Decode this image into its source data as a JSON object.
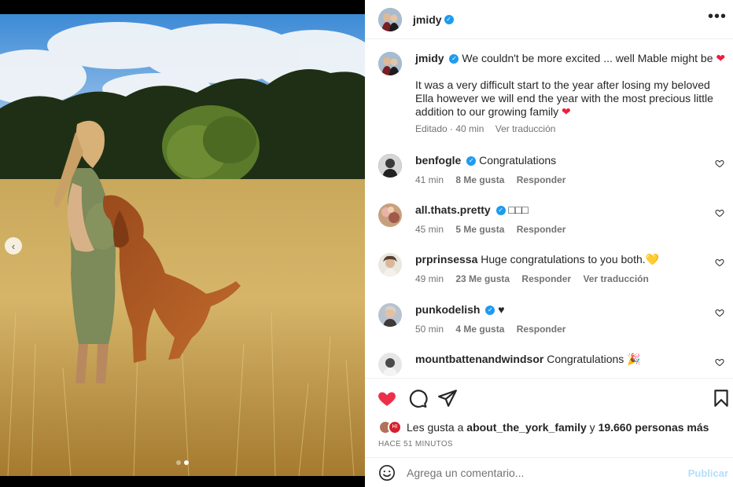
{
  "post": {
    "author": "jmidy",
    "verified": true
  },
  "header": {
    "username": "jmidy",
    "more_icon": "more-horizontal-icon"
  },
  "caption": {
    "username": "jmidy",
    "line1": "We couldn't be more excited ... well Mable might be",
    "line2": "It was a very difficult start to the year after losing my beloved Ella however we will end the year with the most precious little addition to our growing family",
    "emoji": "❤",
    "edited": "Editado · 40 min",
    "translate": "Ver traducción"
  },
  "comments": [
    {
      "username": "benfogle",
      "verified": true,
      "text": "Congratulations",
      "time": "41 min",
      "likes": "8 Me gusta",
      "reply": "Responder",
      "translate": ""
    },
    {
      "username": "all.thats.pretty",
      "verified": true,
      "text": "□□□",
      "time": "45 min",
      "likes": "5 Me gusta",
      "reply": "Responder",
      "translate": ""
    },
    {
      "username": "prprinsessa",
      "verified": false,
      "text": "Huge congratulations to you both.💛",
      "time": "49 min",
      "likes": "23 Me gusta",
      "reply": "Responder",
      "translate": "Ver traducción"
    },
    {
      "username": "punkodelish",
      "verified": true,
      "text": "♥",
      "time": "50 min",
      "likes": "4 Me gusta",
      "reply": "Responder",
      "translate": ""
    },
    {
      "username": "mountbattenandwindsor",
      "verified": false,
      "text": "Congratulations 🎉",
      "time": "",
      "likes": "",
      "reply": "",
      "translate": ""
    }
  ],
  "likes": {
    "prefix": "Les gusta a",
    "user": "about_the_york_family",
    "joiner": "y",
    "others": "19.660 personas más"
  },
  "timestamp": "HACE 51 MINUTOS",
  "add_comment": {
    "placeholder": "Agrega un comentario...",
    "submit": "Publicar"
  },
  "carousel": {
    "count": 2,
    "active_index": 1
  },
  "colors": {
    "like_red": "#ed2f49",
    "verified_blue": "#1d9bf0",
    "publish_disabled": "#b2dffc"
  }
}
